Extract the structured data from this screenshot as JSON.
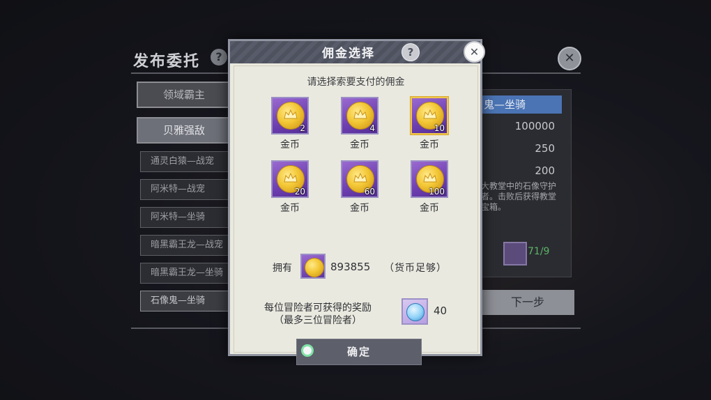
{
  "background": {
    "title": "发布委托",
    "help_glyph": "?",
    "close_glyph": "✕",
    "tabs": [
      {
        "label": "领域霸主"
      },
      {
        "label": "贝雅强敌"
      }
    ],
    "list": [
      {
        "label": "通灵白猿—战宠"
      },
      {
        "label": "阿米特—战宠"
      },
      {
        "label": "阿米特—坐骑"
      },
      {
        "label": "暗黑霸王龙—战宠"
      },
      {
        "label": "暗黑霸王龙—坐骑"
      },
      {
        "label": "石像鬼—坐骑"
      }
    ],
    "detail": {
      "header": "鬼—坐骑",
      "values": [
        "100000",
        "250",
        "200"
      ],
      "description": "大教堂中的石像守护者。击败后获得教堂宝箱。",
      "item_count": "71/9"
    },
    "next_label": "下一步"
  },
  "dialog": {
    "title": "佣金选择",
    "help_glyph": "?",
    "close_glyph": "✕",
    "prompt": "请选择索要支付的佣金",
    "options": [
      {
        "value": "2",
        "label": "金币"
      },
      {
        "value": "4",
        "label": "金币"
      },
      {
        "value": "10",
        "label": "金币",
        "selected": true
      },
      {
        "value": "20",
        "label": "金币"
      },
      {
        "value": "60",
        "label": "金币"
      },
      {
        "value": "100",
        "label": "金币"
      }
    ],
    "owned_label": "拥有",
    "owned_amount": "893855",
    "owned_status": "（货币足够）",
    "reward_label_1": "每位冒险者可获得的奖励",
    "reward_label_2": "（最多三位冒险者）",
    "reward_amount": "40",
    "confirm_label": "确定"
  },
  "colors": {
    "selected_border": "#f0c64d",
    "coin_bg": "#6d3fb0",
    "confirm_ring": "#7fe3a6",
    "count_green": "#5fb267"
  }
}
